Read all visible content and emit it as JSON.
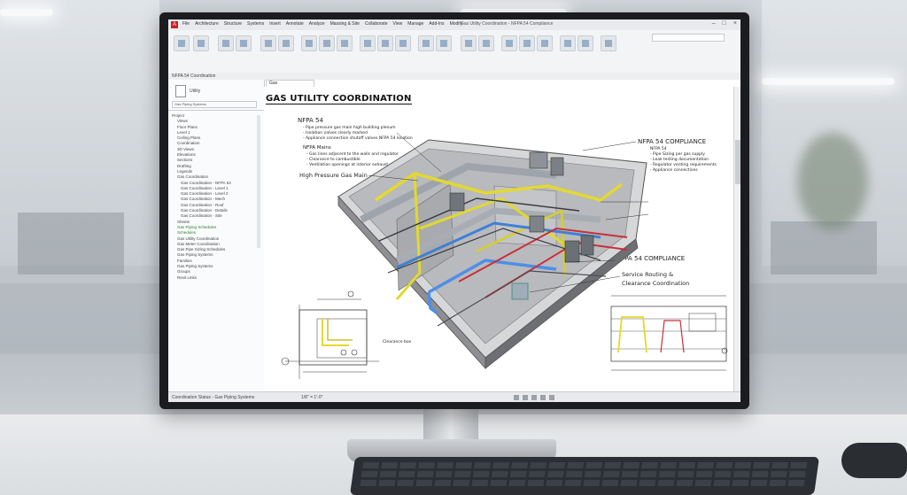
{
  "app": {
    "logo": "A",
    "menu_tabs": [
      "File",
      "Architecture",
      "Structure",
      "Systems",
      "Insert",
      "Annotate",
      "Analyze",
      "Massing & Site",
      "Collaborate",
      "View",
      "Manage",
      "Add-Ins",
      "Modify"
    ],
    "document_title": "Gas Utility Coordination - NFPA 54 Compliance"
  },
  "statusline": "NFPA 54 Coordination",
  "browser": {
    "properties_label": "Utility",
    "properties_type": "Gas Piping Systems",
    "tree": [
      {
        "label": "Project",
        "green": false
      },
      {
        "label": "Views",
        "green": false
      },
      {
        "label": "Floor Plans",
        "green": false
      },
      {
        "label": "Level 1",
        "green": false
      },
      {
        "label": "Ceiling Plans",
        "green": false
      },
      {
        "label": "Coordination",
        "green": false
      },
      {
        "label": "3D Views",
        "green": false
      },
      {
        "label": "Elevations",
        "green": false
      },
      {
        "label": "Sections",
        "green": false
      },
      {
        "label": "Drafting",
        "green": false
      },
      {
        "label": "Legends",
        "green": false
      },
      {
        "label": "Gas Coordination",
        "green": false
      },
      {
        "label": "Gas Coordination - NFPA 54",
        "green": false
      },
      {
        "label": "Gas Coordination - Level 1",
        "green": false
      },
      {
        "label": "Gas Coordination - Level 2",
        "green": false
      },
      {
        "label": "Gas Coordination - Mech",
        "green": false
      },
      {
        "label": "Gas Coordination - Roof",
        "green": false
      },
      {
        "label": "Gas Coordination - Details",
        "green": false
      },
      {
        "label": "Gas Coordination - Site",
        "green": false
      },
      {
        "label": "Sheets",
        "green": false
      },
      {
        "label": "Gas Piping Schedules",
        "green": true
      },
      {
        "label": "Schedules",
        "green": true
      },
      {
        "label": "Gas Utility Coordination",
        "green": false
      },
      {
        "label": "Gas Meter Coordination",
        "green": false
      },
      {
        "label": "Gas Pipe Sizing Schedules",
        "green": false
      },
      {
        "label": "Gas Piping Systems",
        "green": false
      },
      {
        "label": "Families",
        "green": false
      },
      {
        "label": "Gas Piping Systems",
        "green": false
      },
      {
        "label": "Groups",
        "green": false
      },
      {
        "label": "Revit Links",
        "green": false
      }
    ]
  },
  "drawing": {
    "tab": "Gas",
    "sheet_title": "GAS UTILITY COORDINATION",
    "note_left_title": "NFPA 54",
    "note_left_lines": [
      "- Pipe pressure gas main high building plenum",
      "- Isolation valves clearly marked",
      "- Appliance connection shutoff valves NFPA 54 location"
    ],
    "note_left_sub": "NFPA Mains",
    "note_left_sub_lines": [
      "- Gas lines adjacent to the walls and regulator",
      "- Clearance to combustible",
      "- Ventilation openings at interior exhaust"
    ],
    "label_main": "High Pressure Gas Main",
    "nfpa_right_1": "NFPA 54 COMPLIANCE",
    "nfpa_right_1_lines": [
      "NFPA 54",
      "- Pipe Sizing per gas supply",
      "- Leak testing documentation",
      "- Regulator venting requirements",
      "- Appliance connections"
    ],
    "nfpa_right_2": "NFPA 54 COMPLIANCE",
    "service_routing": "Service Routing &",
    "clearance": "Clearance Coordination",
    "clearance_box": "Clearance box"
  },
  "bottombar": {
    "left": "Coordination Status - Gas Piping Systems",
    "scale": "1/8\" = 1'-0\""
  }
}
